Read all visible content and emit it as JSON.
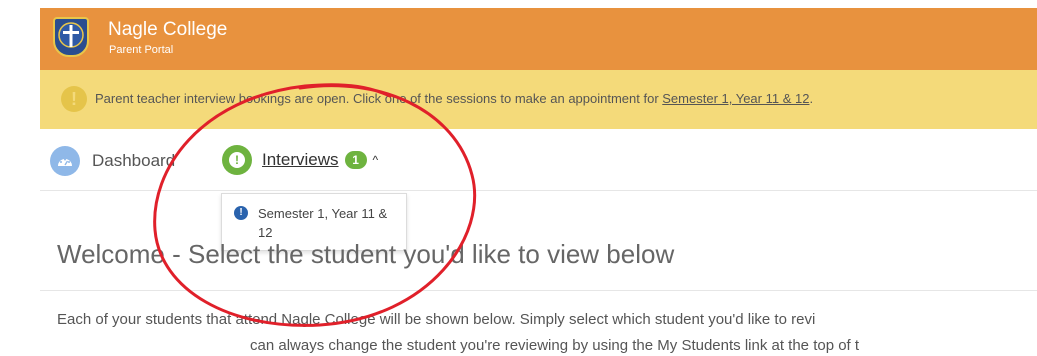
{
  "header": {
    "title": "Nagle College",
    "subtitle": "Parent Portal",
    "logo_icon": "cross-shield-icon"
  },
  "alert": {
    "icon": "exclamation-circle-icon",
    "text": "Parent teacher interview bookings are open. Click one of the sessions to make an appointment for ",
    "link": "Semester 1, Year 11 & 12",
    "trailing": "."
  },
  "nav": {
    "dashboard_label": "Dashboard",
    "dashboard_icon": "speedometer-icon",
    "interviews_label": "Interviews",
    "interviews_icon": "exclamation-circle-icon",
    "interviews_badge": "1",
    "chevron": "^"
  },
  "dropdown": {
    "items": [
      {
        "label": "Semester 1, Year 11 & 12",
        "icon": "exclamation-circle-icon"
      }
    ]
  },
  "main": {
    "heading": "Welcome - Select the student you'd like to view below",
    "paragraph_line1": "Each of your students that attend Nagle College will be shown below. Simply select which student you'd like to revi",
    "paragraph_line2": "can always change the student you're reviewing by using the My Students link at the top of t"
  },
  "colors": {
    "header_bg": "#e8923e",
    "alert_bg": "#f4da7a",
    "success_green": "#6eb33f",
    "info_blue": "#2a63ad",
    "annotation_red": "#e0202a"
  }
}
